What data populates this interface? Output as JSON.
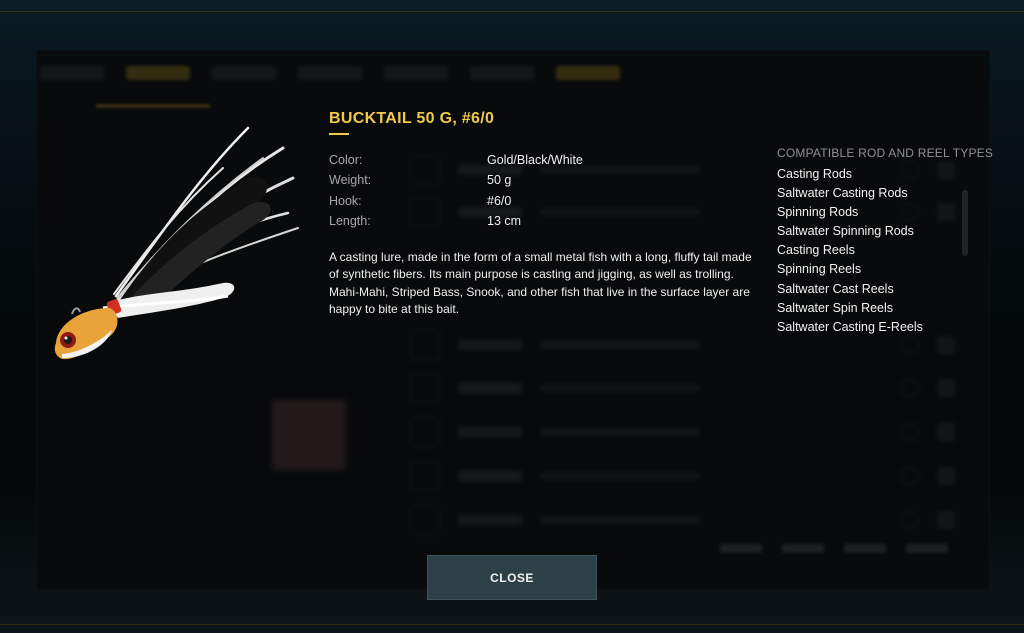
{
  "item": {
    "title": "BUCKTAIL 50 G, #6/0",
    "specs": [
      {
        "label": "Color:",
        "value": "Gold/Black/White"
      },
      {
        "label": "Weight:",
        "value": "50 g"
      },
      {
        "label": "Hook:",
        "value": "#6/0"
      },
      {
        "label": "Length:",
        "value": "13 cm"
      }
    ],
    "description": "A casting lure, made in the form of a small metal fish with a long, fluffy tail made of synthetic fibers. Its main purpose is casting and jigging, as well as trolling. Mahi-Mahi, Striped Bass, Snook, and other fish that live in the surface layer are happy to bite at this bait."
  },
  "compatible": {
    "heading": "COMPATIBLE ROD AND REEL TYPES",
    "items": [
      "Casting Rods",
      "Saltwater Casting Rods",
      "Spinning Rods",
      "Saltwater Spinning Rods",
      "Casting Reels",
      "Spinning Reels",
      "Saltwater Cast Reels",
      "Saltwater Spin Reels",
      "Saltwater Casting E-Reels"
    ]
  },
  "buttons": {
    "close": "CLOSE"
  },
  "colors": {
    "accent": "#f2c94c",
    "button": "#2d4048"
  }
}
